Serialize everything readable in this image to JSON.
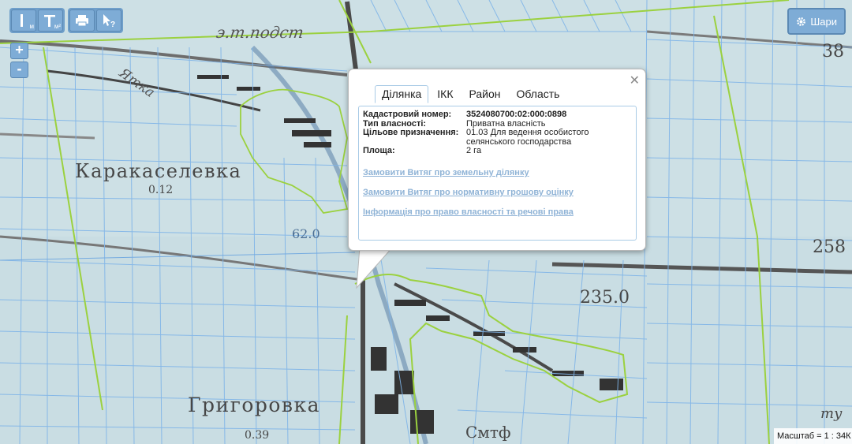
{
  "map": {
    "labels": {
      "village_a": "Каракаселевка",
      "village_a_sub": "0.12",
      "village_b": "Григоровка",
      "village_b_sub": "0.39",
      "stream": "Ятка",
      "top_label": "э.т.подст",
      "elevation_a": "235.0",
      "elevation_b": "258",
      "elevation_c": "38",
      "river_label": "62.0",
      "bottom_label": "Смтф",
      "right_bottom": "ту"
    },
    "colors": {
      "map_base": "#c9dde3",
      "parcel_lines": "#7fb4e8",
      "boundary_green": "#9bd13f",
      "road_dark": "#3a3a3a"
    }
  },
  "toolbar": {
    "measure_distance_sub": "м",
    "measure_area_sub": "м²"
  },
  "layers_button": {
    "label": "Шари"
  },
  "popup": {
    "tabs": [
      "Ділянка",
      "ІКК",
      "Район",
      "Область"
    ],
    "active_tab": "Ділянка",
    "fields": [
      {
        "label": "Кадастровий номер:",
        "value": "3524080700:02:000:0898"
      },
      {
        "label": "Тип власності:",
        "value": "Приватна власність"
      },
      {
        "label": "Цільове призначення:",
        "value": "01.03 Для ведення особистого селянського господарства"
      },
      {
        "label": "Площа:",
        "value": "2 га"
      }
    ],
    "links": [
      "Замовити Витяг про земельну ділянку",
      "Замовити Витяг про нормативну грошову оцінку",
      "Інформація про право власності та речові права"
    ]
  },
  "scale": {
    "label": "Масштаб = 1 : 34К"
  }
}
